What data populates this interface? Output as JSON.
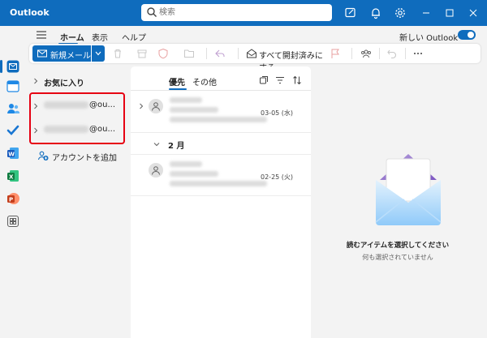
{
  "titlebar": {
    "app_title": "Outlook",
    "search_placeholder": "検索"
  },
  "menu": {
    "tabs": [
      "ホーム",
      "表示",
      "ヘルプ"
    ],
    "new_outlook_label": "新しい Outlook"
  },
  "ribbon": {
    "new_mail_label": "新規メール",
    "mark_all_read_label": "すべて開封済みにする"
  },
  "folders": {
    "favorites_label": "お気に入り",
    "accounts": [
      {
        "domain_suffix": "@ou..."
      },
      {
        "domain_suffix": "@ou..."
      }
    ],
    "add_account_label": "アカウントを追加"
  },
  "message_list": {
    "focused_tab": "優先",
    "other_tab": "その他",
    "messages": [
      {
        "date": "03-05 (水)"
      },
      {
        "date": "02-25 (火)"
      }
    ],
    "group_label": "2 月"
  },
  "reading_pane": {
    "title": "読むアイテムを選択してください",
    "subtitle": "何も選択されていません"
  },
  "colors": {
    "accent": "#0f6cbd",
    "highlight": "#e60012"
  }
}
